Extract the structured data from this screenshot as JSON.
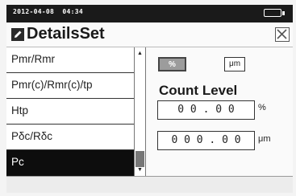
{
  "status": {
    "datetime": "2012-04-08  04:34"
  },
  "header": {
    "title": "DetailsSet"
  },
  "parameter_list": {
    "items": [
      {
        "label": "Pmr/Rmr",
        "selected": false
      },
      {
        "label": "Pmr(c)/Rmr(c)/tp",
        "selected": false
      },
      {
        "label": "Htp",
        "selected": false
      },
      {
        "label": "Pδc/Rδc",
        "selected": false
      },
      {
        "label": "Pc",
        "selected": true
      }
    ],
    "scroll_position": 0.85
  },
  "settings": {
    "unit_percent_label": "%",
    "unit_micron_label": "μm",
    "section_title": "Count Level",
    "percent_value": "0 0 . 0 0",
    "percent_unit": "%",
    "micron_value": "0 0 0 . 0 0",
    "micron_unit": "μm"
  },
  "icons": {
    "edit": "edit-icon",
    "close": "close-icon",
    "battery": "battery-icon",
    "scroll_up": "triangle-up-icon",
    "scroll_down": "triangle-down-icon"
  },
  "colors": {
    "status_bar": "#1a1a1a",
    "selected_item": "#0d0d0d",
    "active_unit": "#9c9c9c"
  }
}
